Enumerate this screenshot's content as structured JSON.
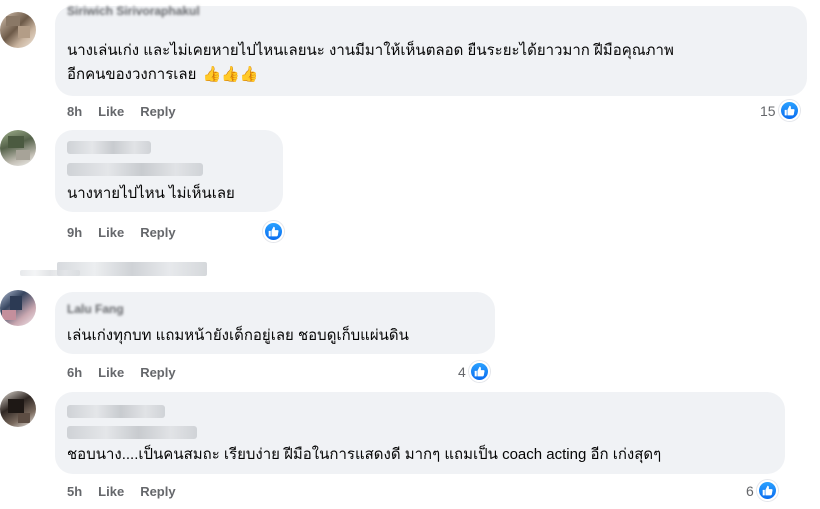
{
  "comments": [
    {
      "author": "Siriwich Sirivoraphakul",
      "lines": [
        "นางเล่นเก่ง และไม่เคยหายไปไหนเลยนะ งานมีมาให้เห็นตลอด ยืนระยะได้ยาวมาก ฝีมือคุณภาพ",
        "อีกคนของวงการเลย"
      ],
      "emoji": "👍👍👍",
      "time": "8h",
      "like_label": "Like",
      "reply_label": "Reply",
      "reaction_count": "15"
    },
    {
      "author": "",
      "lines": [
        "นางหายไปไหน ไม่เห็นเลย"
      ],
      "time": "9h",
      "like_label": "Like",
      "reply_label": "Reply",
      "reaction_count": ""
    },
    {
      "author": "Lalu Fang",
      "lines": [
        "เล่นเก่งทุกบท แถมหน้ายังเด็กอยู่เลย ชอบดูเก็บแผ่นดิน"
      ],
      "time": "6h",
      "like_label": "Like",
      "reply_label": "Reply",
      "reaction_count": "4"
    },
    {
      "author": "",
      "lines": [
        "ชอบนาง....เป็นคนสมถะ เรียบง่าย ฝีมือในการแสดงดี มากๆ แถมเป็น coach acting อีก เก่งสุดๆ"
      ],
      "time": "5h",
      "like_label": "Like",
      "reply_label": "Reply",
      "reaction_count": "6"
    }
  ],
  "icons": {
    "reaction": "like-thumbs-up-icon"
  },
  "colors": {
    "bubble": "#f0f2f5",
    "like_blue": "#1877f2",
    "meta_gray": "#65676b"
  }
}
